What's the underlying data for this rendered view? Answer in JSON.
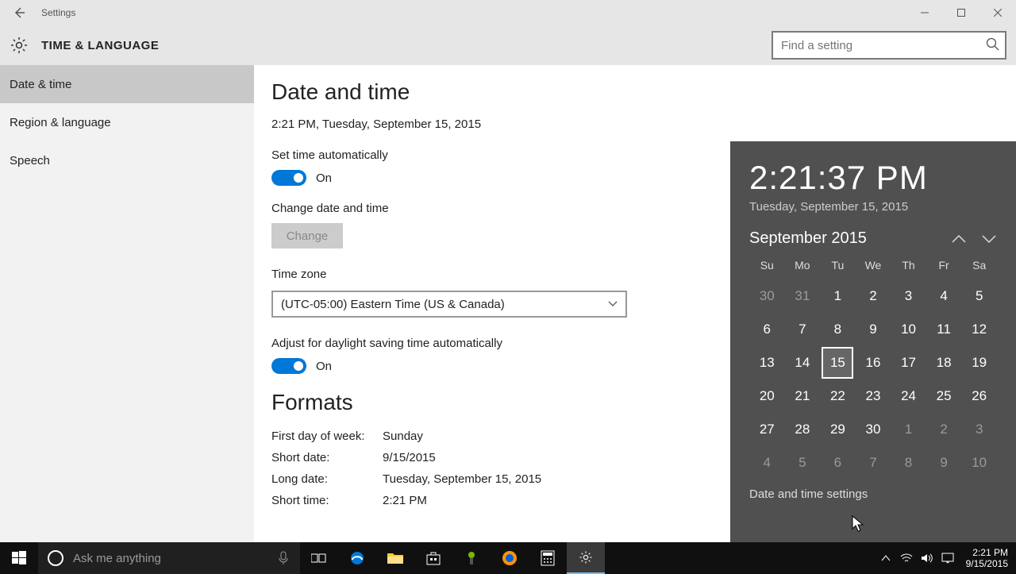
{
  "window": {
    "title": "Settings",
    "header_title": "TIME & LANGUAGE",
    "search_placeholder": "Find a setting"
  },
  "sidebar": {
    "items": [
      {
        "label": "Date & time",
        "active": true
      },
      {
        "label": "Region & language",
        "active": false
      },
      {
        "label": "Speech",
        "active": false
      }
    ]
  },
  "page": {
    "heading": "Date and time",
    "datetime_string": "2:21 PM, Tuesday, September 15, 2015",
    "set_auto_label": "Set time automatically",
    "set_auto_state": "On",
    "change_label": "Change date and time",
    "change_button": "Change",
    "tz_label": "Time zone",
    "tz_value": "(UTC-05:00) Eastern Time (US & Canada)",
    "dst_label": "Adjust for daylight saving time automatically",
    "dst_state": "On",
    "formats_heading": "Formats",
    "formats": {
      "first_day_label": "First day of week:",
      "first_day_value": "Sunday",
      "short_date_label": "Short date:",
      "short_date_value": "9/15/2015",
      "long_date_label": "Long date:",
      "long_date_value": "Tuesday, September 15, 2015",
      "short_time_label": "Short time:",
      "short_time_value": "2:21 PM"
    }
  },
  "flyout": {
    "time": "2:21:37 PM",
    "date": "Tuesday, September 15, 2015",
    "month": "September 2015",
    "weekdays": [
      "Su",
      "Mo",
      "Tu",
      "We",
      "Th",
      "Fr",
      "Sa"
    ],
    "rows": [
      [
        {
          "d": "30",
          "dim": true
        },
        {
          "d": "31",
          "dim": true
        },
        {
          "d": "1"
        },
        {
          "d": "2"
        },
        {
          "d": "3"
        },
        {
          "d": "4"
        },
        {
          "d": "5"
        }
      ],
      [
        {
          "d": "6"
        },
        {
          "d": "7"
        },
        {
          "d": "8"
        },
        {
          "d": "9"
        },
        {
          "d": "10"
        },
        {
          "d": "11"
        },
        {
          "d": "12"
        }
      ],
      [
        {
          "d": "13"
        },
        {
          "d": "14"
        },
        {
          "d": "15",
          "today": true
        },
        {
          "d": "16"
        },
        {
          "d": "17"
        },
        {
          "d": "18"
        },
        {
          "d": "19"
        }
      ],
      [
        {
          "d": "20"
        },
        {
          "d": "21"
        },
        {
          "d": "22"
        },
        {
          "d": "23"
        },
        {
          "d": "24"
        },
        {
          "d": "25"
        },
        {
          "d": "26"
        }
      ],
      [
        {
          "d": "27"
        },
        {
          "d": "28"
        },
        {
          "d": "29"
        },
        {
          "d": "30"
        },
        {
          "d": "1",
          "dim": true
        },
        {
          "d": "2",
          "dim": true
        },
        {
          "d": "3",
          "dim": true
        }
      ],
      [
        {
          "d": "4",
          "dim": true
        },
        {
          "d": "5",
          "dim": true
        },
        {
          "d": "6",
          "dim": true
        },
        {
          "d": "7",
          "dim": true
        },
        {
          "d": "8",
          "dim": true
        },
        {
          "d": "9",
          "dim": true
        },
        {
          "d": "10",
          "dim": true
        }
      ]
    ],
    "settings_link": "Date and time settings"
  },
  "taskbar": {
    "cortana_placeholder": "Ask me anything",
    "clock_time": "2:21 PM",
    "clock_date": "9/15/2015"
  }
}
